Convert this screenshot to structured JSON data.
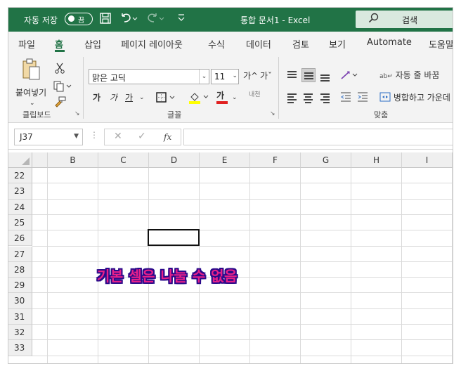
{
  "titlebar": {
    "autosave_label": "자동 저장",
    "toggle_state": "끔",
    "title": "통합 문서1  -  Excel",
    "search_label": "검색",
    "save_icon": "save-icon",
    "undo_icon": "undo-icon",
    "redo_icon": "redo-icon"
  },
  "tabs": [
    "파일",
    "홈",
    "삽입",
    "페이지 레이아웃",
    "수식",
    "데이터",
    "검토",
    "보기",
    "Automate",
    "도움말"
  ],
  "active_tab": "홈",
  "ribbon": {
    "clipboard": {
      "paste_label": "붙여넣기",
      "group_label": "클립보드"
    },
    "font": {
      "font_name": "맑은 고딕",
      "font_size": "11",
      "grow": "가^",
      "shrink": "가ˇ",
      "bold": "가",
      "italic": "가",
      "underline": "가",
      "font_color_glyph": "가",
      "phonetic": "내천",
      "group_label": "글꼴"
    },
    "alignment": {
      "wrap_text": "자동 줄 바꿈",
      "merge_center": "병합하고 가운데 맞춤",
      "group_label": "맞춤"
    }
  },
  "formula_bar": {
    "name_box": "J37",
    "cancel_glyph": "✕",
    "enter_glyph": "✓",
    "fx_glyph": "fx",
    "formula": ""
  },
  "grid": {
    "columns": [
      "B",
      "C",
      "D",
      "E",
      "F",
      "G",
      "H",
      "I"
    ],
    "rows": [
      "22",
      "23",
      "24",
      "25",
      "26",
      "27",
      "28",
      "29",
      "30",
      "31",
      "32",
      "33"
    ],
    "selected_cell": "D26"
  },
  "annotation": "기본 셀은 나눌 수 없음",
  "colors": {
    "excel_green": "#217346",
    "annotation_fill": "#e8208a",
    "annotation_outline": "#2a0a8a"
  }
}
